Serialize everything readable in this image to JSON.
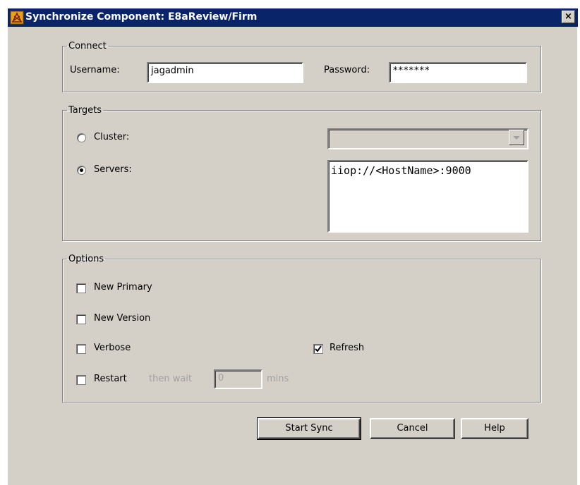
{
  "window": {
    "title": "Synchronize Component: E8aReview/Firm",
    "close_label": "×"
  },
  "connect": {
    "legend": "Connect",
    "username_label": "Username:",
    "username_value": "jagadmin",
    "password_label": "Password:",
    "password_value": "*******"
  },
  "targets": {
    "legend": "Targets",
    "cluster_label": "Cluster:",
    "cluster_value": "",
    "servers_label": "Servers:",
    "servers_value": "iiop://<HostName>:9000",
    "selected": "servers"
  },
  "options": {
    "legend": "Options",
    "new_primary_label": "New Primary",
    "new_primary_checked": false,
    "new_version_label": "New Version",
    "new_version_checked": false,
    "verbose_label": "Verbose",
    "verbose_checked": false,
    "refresh_label": "Refresh",
    "refresh_checked": true,
    "restart_label": "Restart",
    "restart_checked": false,
    "then_wait_label": "then wait",
    "wait_value": "0",
    "mins_label": "mins"
  },
  "buttons": {
    "start_sync": "Start Sync",
    "cancel": "Cancel",
    "help": "Help"
  },
  "icons": {
    "app": "component-sync-icon",
    "check": "checkmark-icon",
    "dropdown": "chevron-down-icon"
  }
}
